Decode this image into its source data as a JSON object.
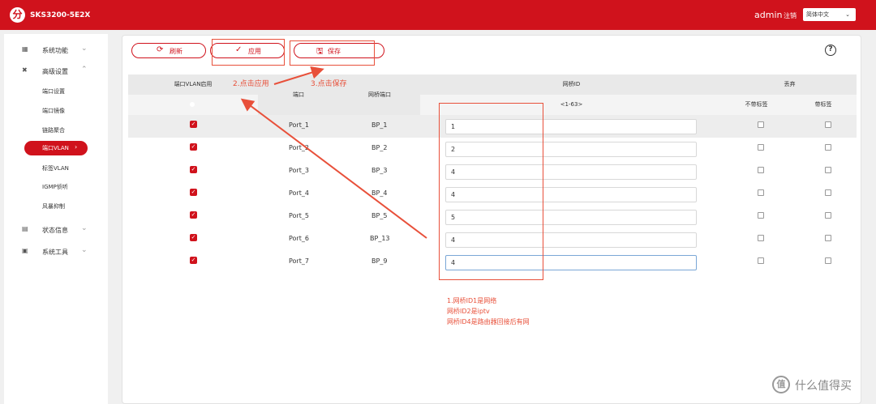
{
  "header": {
    "logo_glyph": "分",
    "product": "SKS3200-5E2X",
    "user": "admin",
    "logout": "注销",
    "language": "简体中文",
    "accent": "#d0121c"
  },
  "sidebar": {
    "sys_func": "系统功能",
    "advanced": "高级设置",
    "port_settings": "端口设置",
    "port_mirror": "端口镜像",
    "link_agg": "链路聚合",
    "port_vlan": "端口VLAN",
    "tag_vlan": "标签VLAN",
    "igmp": "IGMP侦听",
    "storm": "风暴抑制",
    "status": "状态信息",
    "tools": "系统工具"
  },
  "toolbar": {
    "refresh": "刷新",
    "apply": "应用",
    "save": "保存",
    "help": "?"
  },
  "table": {
    "col_enable": "端口VLAN启用",
    "col_port": "端口",
    "col_bp": "网桥端口",
    "col_bridge_id": "网桥ID",
    "col_bridge_range": "<1-63>",
    "col_discard": "丢弃",
    "col_untagged": "不带标签",
    "col_tagged": "带标签",
    "rows": [
      {
        "enabled": true,
        "port": "Port_1",
        "bp": "BP_1",
        "bridge_id": "1",
        "untagged": false,
        "tagged": false
      },
      {
        "enabled": true,
        "port": "Port_2",
        "bp": "BP_2",
        "bridge_id": "2",
        "untagged": false,
        "tagged": false
      },
      {
        "enabled": true,
        "port": "Port_3",
        "bp": "BP_3",
        "bridge_id": "4",
        "untagged": false,
        "tagged": false
      },
      {
        "enabled": true,
        "port": "Port_4",
        "bp": "BP_4",
        "bridge_id": "4",
        "untagged": false,
        "tagged": false
      },
      {
        "enabled": true,
        "port": "Port_5",
        "bp": "BP_5",
        "bridge_id": "5",
        "untagged": false,
        "tagged": false
      },
      {
        "enabled": true,
        "port": "Port_6",
        "bp": "BP_13",
        "bridge_id": "4",
        "untagged": false,
        "tagged": false
      },
      {
        "enabled": true,
        "port": "Port_7",
        "bp": "BP_9",
        "bridge_id": "4",
        "untagged": false,
        "tagged": false
      }
    ]
  },
  "annotations": {
    "step2": "2.点击应用",
    "step3": "3.点击保存",
    "note1": "1.网桥ID1是网络",
    "note2": "网桥ID2是iptv",
    "note3": "网桥ID4是路由器回接后有网"
  },
  "watermark": {
    "text": "什么值得买",
    "glyph": "值"
  }
}
